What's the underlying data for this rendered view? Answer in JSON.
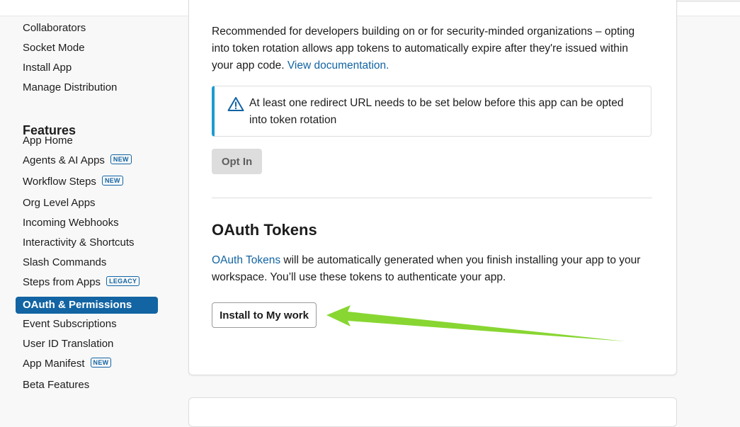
{
  "sidebar": {
    "items_top": [
      "Collaborators",
      "Socket Mode",
      "Install App",
      "Manage Distribution"
    ],
    "features_heading": "Features",
    "features_items": [
      {
        "label": "App Home",
        "badge": ""
      },
      {
        "label": "Agents & AI Apps",
        "badge": "NEW"
      },
      {
        "label": "Workflow Steps",
        "badge": "NEW"
      },
      {
        "label": "Org Level Apps",
        "badge": ""
      },
      {
        "label": "Incoming Webhooks",
        "badge": ""
      },
      {
        "label": "Interactivity & Shortcuts",
        "badge": ""
      },
      {
        "label": "Slash Commands",
        "badge": ""
      },
      {
        "label": "Steps from Apps",
        "badge": "LEGACY"
      },
      {
        "label": "OAuth & Permissions",
        "badge": "",
        "active": true
      },
      {
        "label": "Event Subscriptions",
        "badge": ""
      },
      {
        "label": "User ID Translation",
        "badge": ""
      },
      {
        "label": "App Manifest",
        "badge": "NEW"
      },
      {
        "label": "Beta Features",
        "badge": ""
      }
    ]
  },
  "token_rotation": {
    "description_before_link": "Recommended for developers building on or for security-minded organizations – opting into token rotation allows app tokens to automatically expire after they're issued within your app code. ",
    "link_label": "View documentation.",
    "alert_text": "At least one redirect URL needs to be set below before this app can be opted into token rotation",
    "opt_in_label": "Opt In"
  },
  "oauth_tokens": {
    "title": "OAuth Tokens",
    "link_label": "OAuth Tokens",
    "description_after_link": " will be automatically generated when you finish installing your app to your workspace. You’ll use these tokens to authenticate your app.",
    "install_label": "Install to My work"
  },
  "colors": {
    "accent": "#1264a3",
    "alert_border": "#1d9bd1",
    "annotation_arrow": "#7ed321"
  }
}
